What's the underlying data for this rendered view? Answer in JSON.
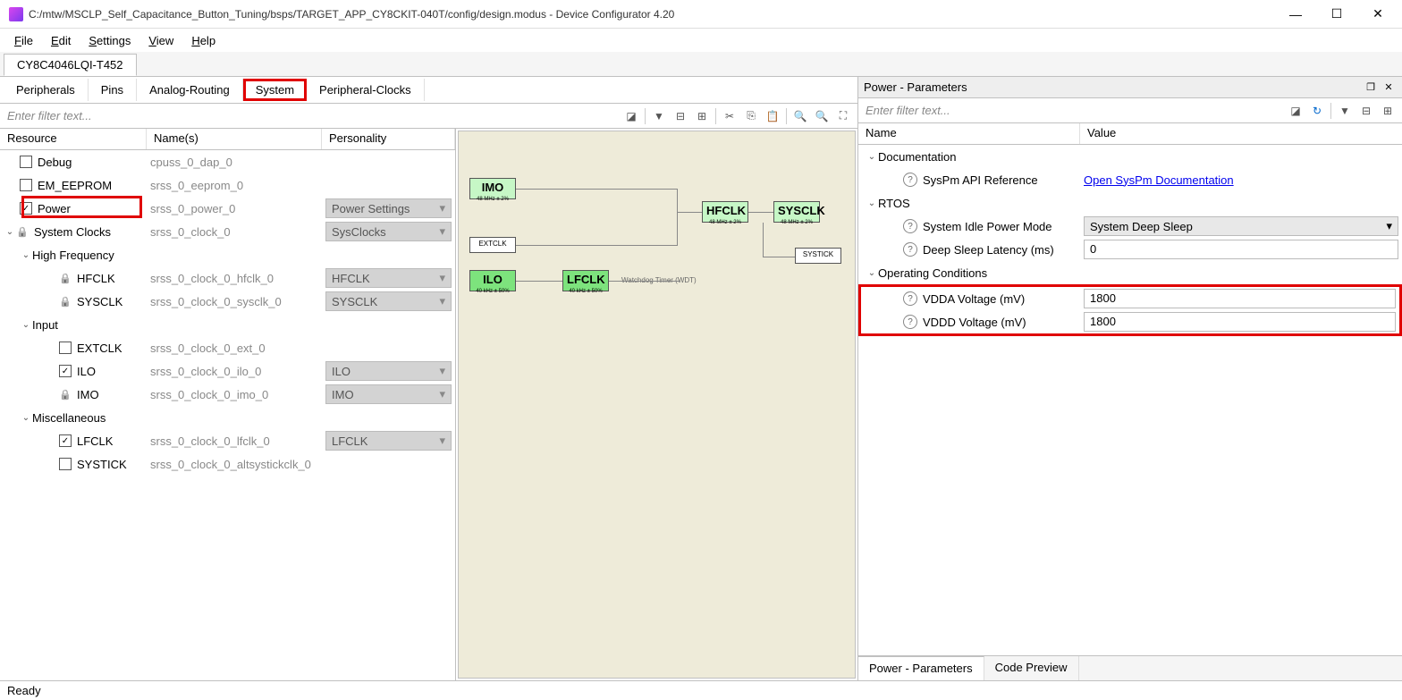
{
  "window": {
    "title": "C:/mtw/MSCLP_Self_Capacitance_Button_Tuning/bsps/TARGET_APP_CY8CKIT-040T/config/design.modus - Device Configurator 4.20"
  },
  "menu": {
    "file": "File",
    "edit": "Edit",
    "settings": "Settings",
    "view": "View",
    "help": "Help"
  },
  "device_tab": "CY8C4046LQI-T452",
  "subtabs": {
    "peripherals": "Peripherals",
    "pins": "Pins",
    "analog": "Analog-Routing",
    "system": "System",
    "pclocks": "Peripheral-Clocks"
  },
  "filter_placeholder": "Enter filter text...",
  "tree_cols": {
    "resource": "Resource",
    "names": "Name(s)",
    "personality": "Personality"
  },
  "tree": {
    "debug": {
      "label": "Debug",
      "name": "cpuss_0_dap_0"
    },
    "eeprom": {
      "label": "EM_EEPROM",
      "name": "srss_0_eeprom_0"
    },
    "power": {
      "label": "Power",
      "name": "srss_0_power_0",
      "pers": "Power Settings"
    },
    "sysclocks": {
      "label": "System Clocks",
      "name": "srss_0_clock_0",
      "pers": "SysClocks"
    },
    "hf": {
      "label": "High Frequency"
    },
    "hfclk": {
      "label": "HFCLK",
      "name": "srss_0_clock_0_hfclk_0",
      "pers": "HFCLK"
    },
    "sysclk": {
      "label": "SYSCLK",
      "name": "srss_0_clock_0_sysclk_0",
      "pers": "SYSCLK"
    },
    "input": {
      "label": "Input"
    },
    "extclk": {
      "label": "EXTCLK",
      "name": "srss_0_clock_0_ext_0"
    },
    "ilo": {
      "label": "ILO",
      "name": "srss_0_clock_0_ilo_0",
      "pers": "ILO"
    },
    "imo": {
      "label": "IMO",
      "name": "srss_0_clock_0_imo_0",
      "pers": "IMO"
    },
    "misc": {
      "label": "Miscellaneous"
    },
    "lfclk": {
      "label": "LFCLK",
      "name": "srss_0_clock_0_lfclk_0",
      "pers": "LFCLK"
    },
    "systick": {
      "label": "SYSTICK",
      "name": "srss_0_clock_0_altsystickclk_0"
    }
  },
  "diagram": {
    "imo": "IMO",
    "imo_sub": "48 MHz ± 2%",
    "extclk": "EXTCLK",
    "ilo": "ILO",
    "ilo_sub": "40 kHz ± 50%",
    "lfclk": "LFCLK",
    "lfclk_sub": "40 kHz ± 50%",
    "hfclk": "HFCLK",
    "hfclk_sub": "48 MHz ± 2%",
    "sysclk": "SYSCLK",
    "sysclk_sub": "48 MHz ± 2%",
    "systick": "SYSTICK",
    "wdt": "Watchdog Timer (WDT)"
  },
  "right_panel": {
    "title": "Power - Parameters",
    "filter_placeholder": "Enter filter text...",
    "cols": {
      "name": "Name",
      "value": "Value"
    },
    "doc_section": "Documentation",
    "syspm_ref": "SysPm API Reference",
    "syspm_link": "Open SysPm Documentation",
    "rtos_section": "RTOS",
    "idle_mode_label": "System Idle Power Mode",
    "idle_mode_value": "System Deep Sleep",
    "deep_sleep_label": "Deep Sleep Latency (ms)",
    "deep_sleep_value": "0",
    "opcond_section": "Operating Conditions",
    "vdda_label": "VDDA Voltage (mV)",
    "vdda_value": "1800",
    "vddd_label": "VDDD Voltage (mV)",
    "vddd_value": "1800"
  },
  "bottom_tabs": {
    "params": "Power - Parameters",
    "code": "Code Preview"
  },
  "status": "Ready"
}
